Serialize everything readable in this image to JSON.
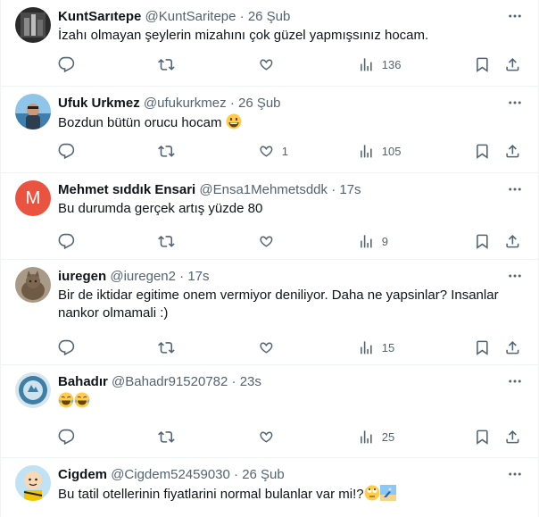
{
  "tweets": [
    {
      "name": "KuntSarıtepe",
      "handle": "@KuntSaritepe",
      "dot": "·",
      "time": "26 Şub",
      "text": "İzahı olmayan şeylerin mizahını çok güzel yapmışsınız hocam.",
      "avatar": "dark-photo-avatar",
      "replies": "",
      "retweets": "",
      "likes": "",
      "views": "136"
    },
    {
      "name": "Ufuk Urkmez",
      "handle": "@ufukurkmez",
      "dot": "·",
      "time": "26 Şub",
      "text": "Bozdun bütün orucu hocam",
      "emoji": "grinning-face",
      "avatar": "beach-photo-avatar",
      "replies": "",
      "retweets": "",
      "likes": "1",
      "views": "105"
    },
    {
      "name": "Mehmet sıddık Ensari",
      "handle": "@Ensa1Mehmetsddk",
      "dot": "·",
      "time": "17s",
      "text": "Bu durumda gerçek artış yüzde 80",
      "avatar": "letter-avatar",
      "avatar_letter": "M",
      "avatar_color": "#e9533f",
      "replies": "",
      "retweets": "",
      "likes": "",
      "views": "9"
    },
    {
      "name": "iuregen",
      "handle": "@iuregen2",
      "dot": "·",
      "time": "17s",
      "text_lines": [
        "Bir de iktidar egitime onem vermiyor deniliyor. Daha ne yapsinlar? Insanlar",
        "nankor olmamali :)"
      ],
      "avatar": "cat-photo-avatar",
      "replies": "",
      "retweets": "",
      "likes": "",
      "views": "15"
    },
    {
      "name": "Bahadır",
      "handle": "@Bahadr91520782",
      "dot": "·",
      "time": "23s",
      "text": "",
      "emoji": "tears-of-joy-x2",
      "avatar": "emblem-avatar",
      "replies": "",
      "retweets": "",
      "likes": "",
      "views": "25"
    },
    {
      "name": "Cigdem",
      "handle": "@Cigdem52459030",
      "dot": "·",
      "time": "26 Şub",
      "text": "Bu tatil otellerinin fiyatlarini normal bulanlar var mi!?",
      "emoji": "rolling-eyes-and-beach",
      "avatar": "cartoon-avatar",
      "replies": "",
      "retweets": "",
      "likes": "",
      "views": ""
    }
  ],
  "colors": {
    "text": "#0f1419",
    "muted": "#536471",
    "border": "#eff3f4"
  }
}
